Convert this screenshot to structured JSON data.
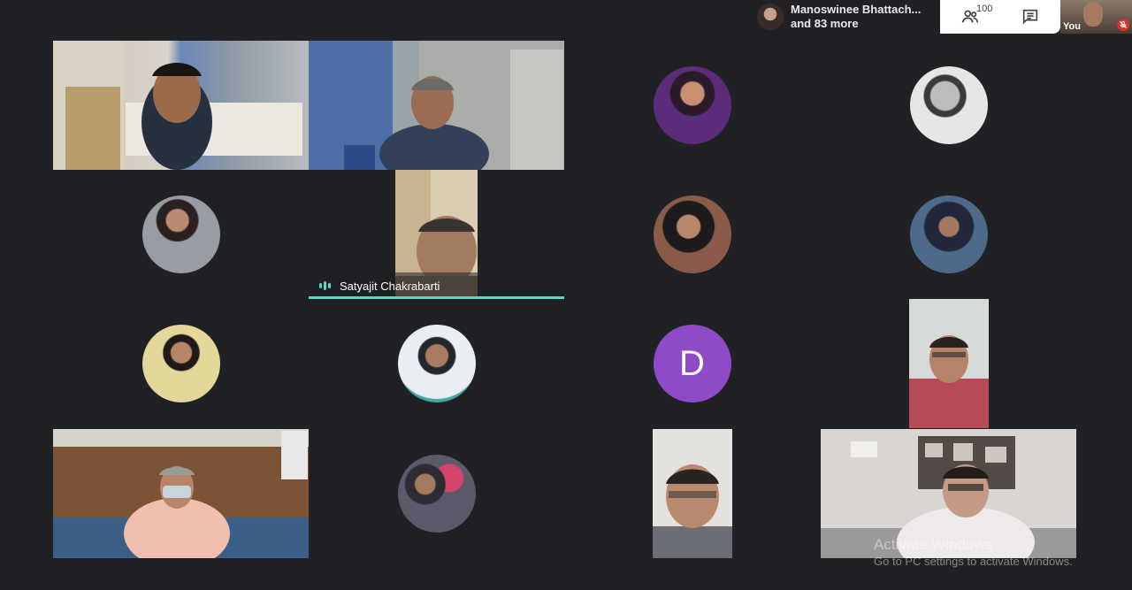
{
  "topbar": {
    "presenter_name": "Manoswinee Bhattach...",
    "presenter_more": "and 83 more",
    "participant_count": "100",
    "self_label": "You"
  },
  "tiles": {
    "active_speaker": "Satyajit Chakrabarti",
    "letter_avatar": "D"
  },
  "watermark": {
    "line1": "Activate Windows",
    "line2": "Go to PC settings to activate Windows."
  },
  "colors": {
    "background": "#202124",
    "speaking_accent": "#5bd6c4",
    "letter_avatar_bg": "#8e4ac7",
    "muted_red": "#d93025"
  }
}
